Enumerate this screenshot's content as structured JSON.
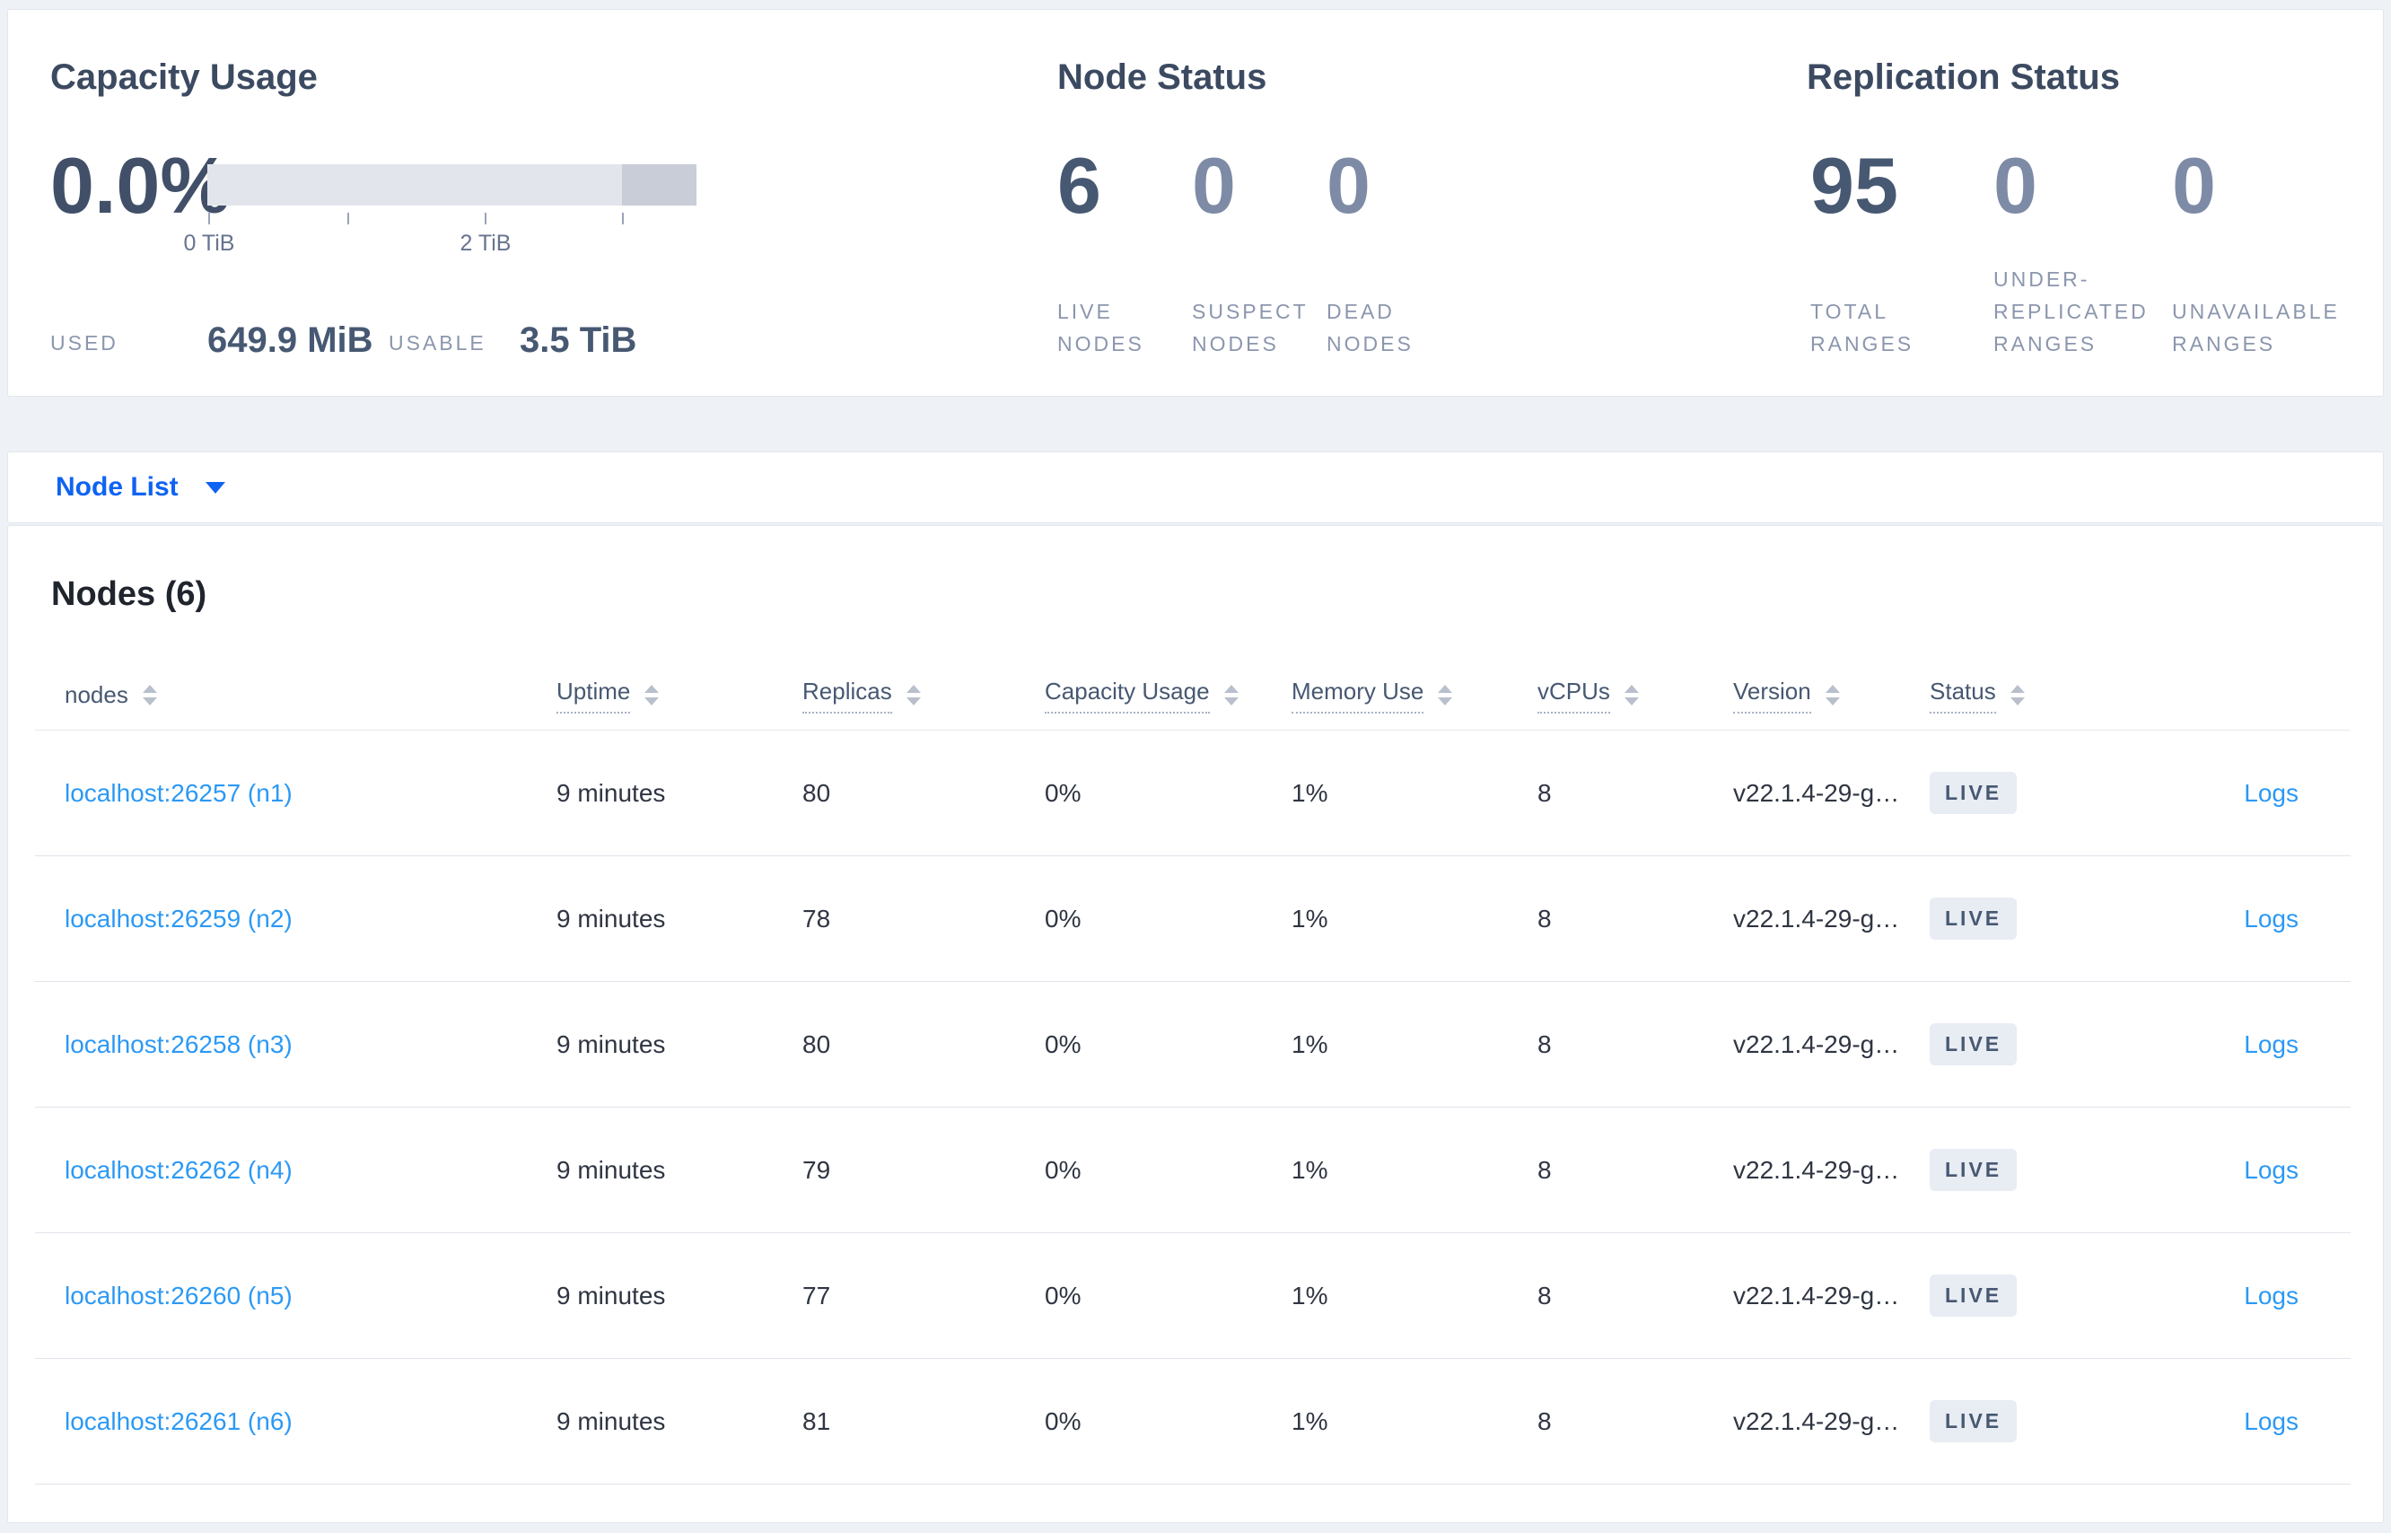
{
  "colors": {
    "page_bg": "#eef1f6",
    "card_bg": "#ffffff",
    "brand_blue": "#0f63f2",
    "link_blue": "#2c99f4",
    "num_dark": "#475872",
    "num_light": "#7e8ba6",
    "label_gray": "#8b96ad",
    "bar_light": "#e2e5eb",
    "bar_dark": "#c9cdd8",
    "badge_bg": "#e8ecf3"
  },
  "summary": {
    "capacity": {
      "title": "Capacity Usage",
      "percent": "0.0%",
      "tick_labels": [
        "0 TiB",
        "2 TiB"
      ],
      "used_label": "USED",
      "used_value": "649.9 MiB",
      "usable_label": "USABLE",
      "usable_value": "3.5 TiB"
    },
    "node_status": {
      "title": "Node Status",
      "stats": [
        {
          "value": "6",
          "label": "LIVE NODES",
          "emph": true
        },
        {
          "value": "0",
          "label": "SUSPECT NODES",
          "emph": false
        },
        {
          "value": "0",
          "label": "DEAD NODES",
          "emph": false
        }
      ]
    },
    "replication": {
      "title": "Replication Status",
      "stats": [
        {
          "value": "95",
          "label": "TOTAL RANGES",
          "emph": true
        },
        {
          "value": "0",
          "label": "UNDER-REPLICATED RANGES",
          "emph": false
        },
        {
          "value": "0",
          "label": "UNAVAILABLE RANGES",
          "emph": false
        }
      ]
    }
  },
  "view_selector": {
    "label": "Node List"
  },
  "nodes_panel": {
    "title": "Nodes (6)",
    "columns": [
      {
        "label": "nodes",
        "dotted": false
      },
      {
        "label": "Uptime",
        "dotted": true
      },
      {
        "label": "Replicas",
        "dotted": true
      },
      {
        "label": "Capacity Usage",
        "dotted": true
      },
      {
        "label": "Memory Use",
        "dotted": true
      },
      {
        "label": "vCPUs",
        "dotted": true
      },
      {
        "label": "Version",
        "dotted": true
      },
      {
        "label": "Status",
        "dotted": true
      }
    ],
    "rows": [
      {
        "address": "localhost:26257 (n1)",
        "uptime": "9 minutes",
        "replicas": "80",
        "capacity": "0%",
        "memory": "1%",
        "vcpus": "8",
        "version": "v22.1.4-29-g…",
        "status": "LIVE",
        "logs": "Logs"
      },
      {
        "address": "localhost:26259 (n2)",
        "uptime": "9 minutes",
        "replicas": "78",
        "capacity": "0%",
        "memory": "1%",
        "vcpus": "8",
        "version": "v22.1.4-29-g…",
        "status": "LIVE",
        "logs": "Logs"
      },
      {
        "address": "localhost:26258 (n3)",
        "uptime": "9 minutes",
        "replicas": "80",
        "capacity": "0%",
        "memory": "1%",
        "vcpus": "8",
        "version": "v22.1.4-29-g…",
        "status": "LIVE",
        "logs": "Logs"
      },
      {
        "address": "localhost:26262 (n4)",
        "uptime": "9 minutes",
        "replicas": "79",
        "capacity": "0%",
        "memory": "1%",
        "vcpus": "8",
        "version": "v22.1.4-29-g…",
        "status": "LIVE",
        "logs": "Logs"
      },
      {
        "address": "localhost:26260 (n5)",
        "uptime": "9 minutes",
        "replicas": "77",
        "capacity": "0%",
        "memory": "1%",
        "vcpus": "8",
        "version": "v22.1.4-29-g…",
        "status": "LIVE",
        "logs": "Logs"
      },
      {
        "address": "localhost:26261 (n6)",
        "uptime": "9 minutes",
        "replicas": "81",
        "capacity": "0%",
        "memory": "1%",
        "vcpus": "8",
        "version": "v22.1.4-29-g…",
        "status": "LIVE",
        "logs": "Logs"
      }
    ]
  }
}
